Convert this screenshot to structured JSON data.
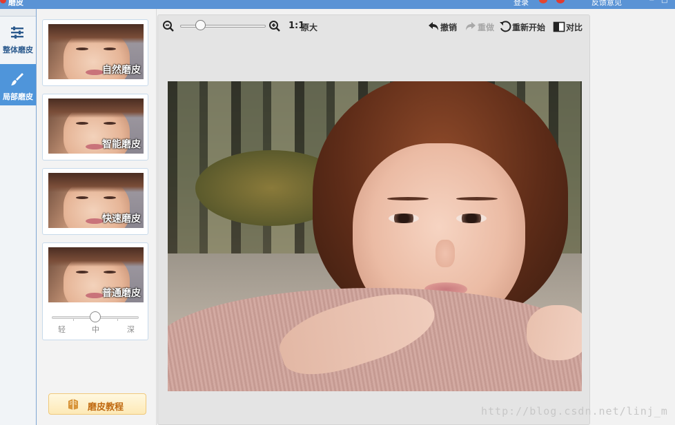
{
  "titlebar": {
    "app_title": "磨皮",
    "login_label": "登录",
    "feedback_label": "反馈意见"
  },
  "rail": {
    "items": [
      {
        "label": "整体磨皮",
        "icon": "sliders-icon",
        "active": false
      },
      {
        "label": "局部磨皮",
        "icon": "brush-icon",
        "active": true
      }
    ]
  },
  "presets": {
    "items": [
      {
        "caption": "自然磨皮"
      },
      {
        "caption": "智能磨皮"
      },
      {
        "caption": "快速磨皮"
      },
      {
        "caption": "普通磨皮"
      }
    ],
    "strength": {
      "labels": [
        "轻",
        "中",
        "深"
      ],
      "selected": "中",
      "value_fraction": 0.5
    },
    "tutorial_label": "磨皮教程"
  },
  "toolbar": {
    "zoom_out_icon": "zoom-out-icon",
    "zoom_in_icon": "zoom-in-icon",
    "zoom_fraction": 0.22,
    "ratio_label": "1:1",
    "original_label": "原大",
    "undo_label": "撤销",
    "redo_label": "重做",
    "reset_label": "重新开始",
    "compare_label": "对比"
  },
  "watermark": "http://blog.csdn.net/linj_m",
  "colors": {
    "title_bar": "#5a93d5",
    "rail_active": "#4f95da",
    "card_border": "#c6d9ea",
    "tutorial_text": "#c06a11"
  }
}
